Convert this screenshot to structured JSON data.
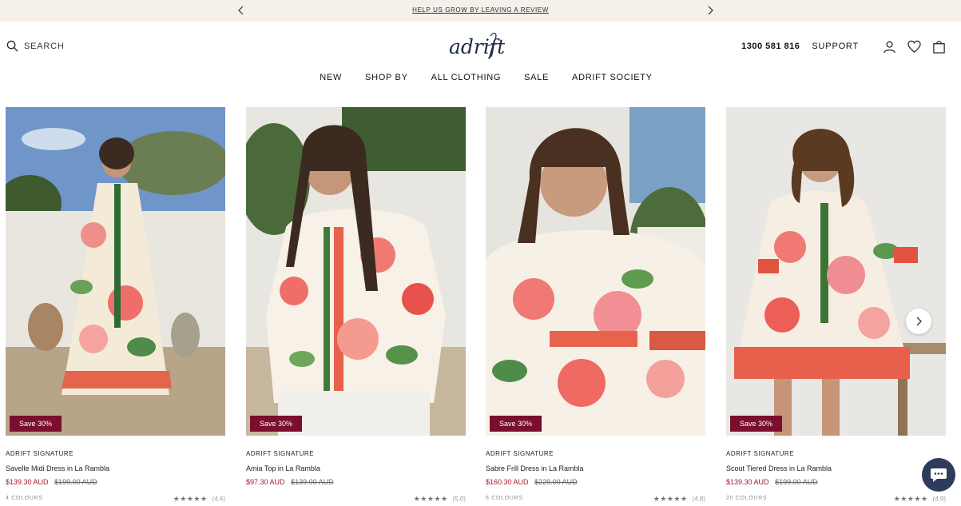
{
  "announcement": {
    "text": "HELP US GROW BY LEAVING A REVIEW"
  },
  "header": {
    "search_label": "SEARCH",
    "logo_text": "adrift",
    "phone": "1300 581 816",
    "support_label": "SUPPORT"
  },
  "nav": {
    "items": [
      {
        "label": "NEW"
      },
      {
        "label": "SHOP BY"
      },
      {
        "label": "ALL CLOTHING"
      },
      {
        "label": "SALE"
      },
      {
        "label": "ADRIFT SOCIETY"
      }
    ]
  },
  "products": [
    {
      "badge": "Save 30%",
      "brand": "ADRIFT SIGNATURE",
      "name": "Savelle Midi Dress in La Rambla",
      "sale_price": "$139.30 AUD",
      "original_price": "$199.00 AUD",
      "colours": "4 COLOURS",
      "stars": "★★★★★",
      "rating": "(4.6)"
    },
    {
      "badge": "Save 30%",
      "brand": "ADRIFT SIGNATURE",
      "name": "Amia Top in La Rambla",
      "sale_price": "$97.30 AUD",
      "original_price": "$139.00 AUD",
      "colours": "",
      "stars": "★★★★★",
      "rating": "(5.0)"
    },
    {
      "badge": "Save 30%",
      "brand": "ADRIFT SIGNATURE",
      "name": "Sabre Frill Dress in La Rambla",
      "sale_price": "$160.30 AUD",
      "original_price": "$229.00 AUD",
      "colours": "6 COLOURS",
      "stars": "★★★★★",
      "rating": "(4.8)"
    },
    {
      "badge": "Save 30%",
      "brand": "ADRIFT SIGNATURE",
      "name": "Scout Tiered Dress in La Rambla",
      "sale_price": "$139.30 AUD",
      "original_price": "$199.00 AUD",
      "colours": "20 COLOURS",
      "stars": "★★★★★",
      "rating": "(4.9)"
    }
  ],
  "colors": {
    "announcement_bg": "#f5f1ea",
    "sale_badge": "#7a0e2c",
    "sale_price": "#a2192e",
    "chat_button": "#2c3c5a",
    "logo": "#1f2b4a"
  },
  "icons": [
    "chevron-left-icon",
    "chevron-right-icon",
    "search-icon",
    "account-icon",
    "heart-icon",
    "bag-icon",
    "chat-icon"
  ]
}
